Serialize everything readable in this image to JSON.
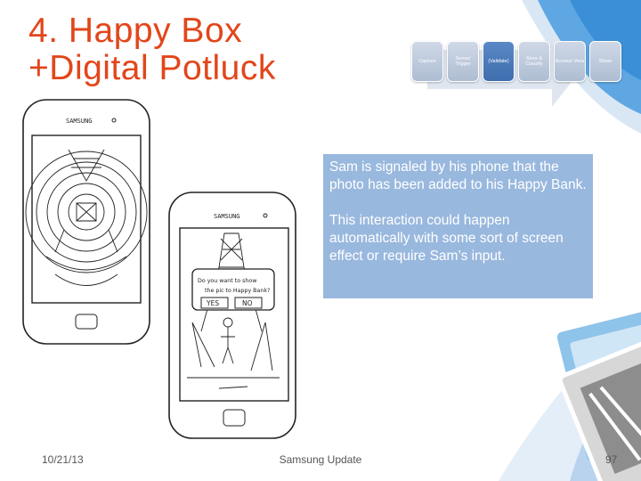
{
  "title": {
    "line1": "4. Happy Box",
    "line2": "+Digital Potluck"
  },
  "process_steps": [
    {
      "label": "Capture",
      "active": false
    },
    {
      "label": "Sense/ Trigger",
      "active": false
    },
    {
      "label": "(Validate)",
      "active": true
    },
    {
      "label": "Store & Classify",
      "active": false
    },
    {
      "label": "Access/ View",
      "active": false
    },
    {
      "label": "Share",
      "active": false
    }
  ],
  "info": {
    "paragraph1": "Sam is signaled by his phone that the photo has been added to his Happy Bank.",
    "paragraph2": "This interaction could happen automatically with some sort of screen effect or require Sam’s input."
  },
  "sketch": {
    "brand": "SAMSUNG",
    "dialog_line1": "Do you want to show",
    "dialog_line2": "the pic to Happy Bank?",
    "yes_label": "YES",
    "no_label": "NO"
  },
  "footer": {
    "date": "10/21/13",
    "center": "Samsung Update",
    "page": "97"
  },
  "colors": {
    "title": "#e2461b",
    "info_box": "#99b8de",
    "accent_blue": "#3a8fd6",
    "active_step": "#4a78b8"
  }
}
